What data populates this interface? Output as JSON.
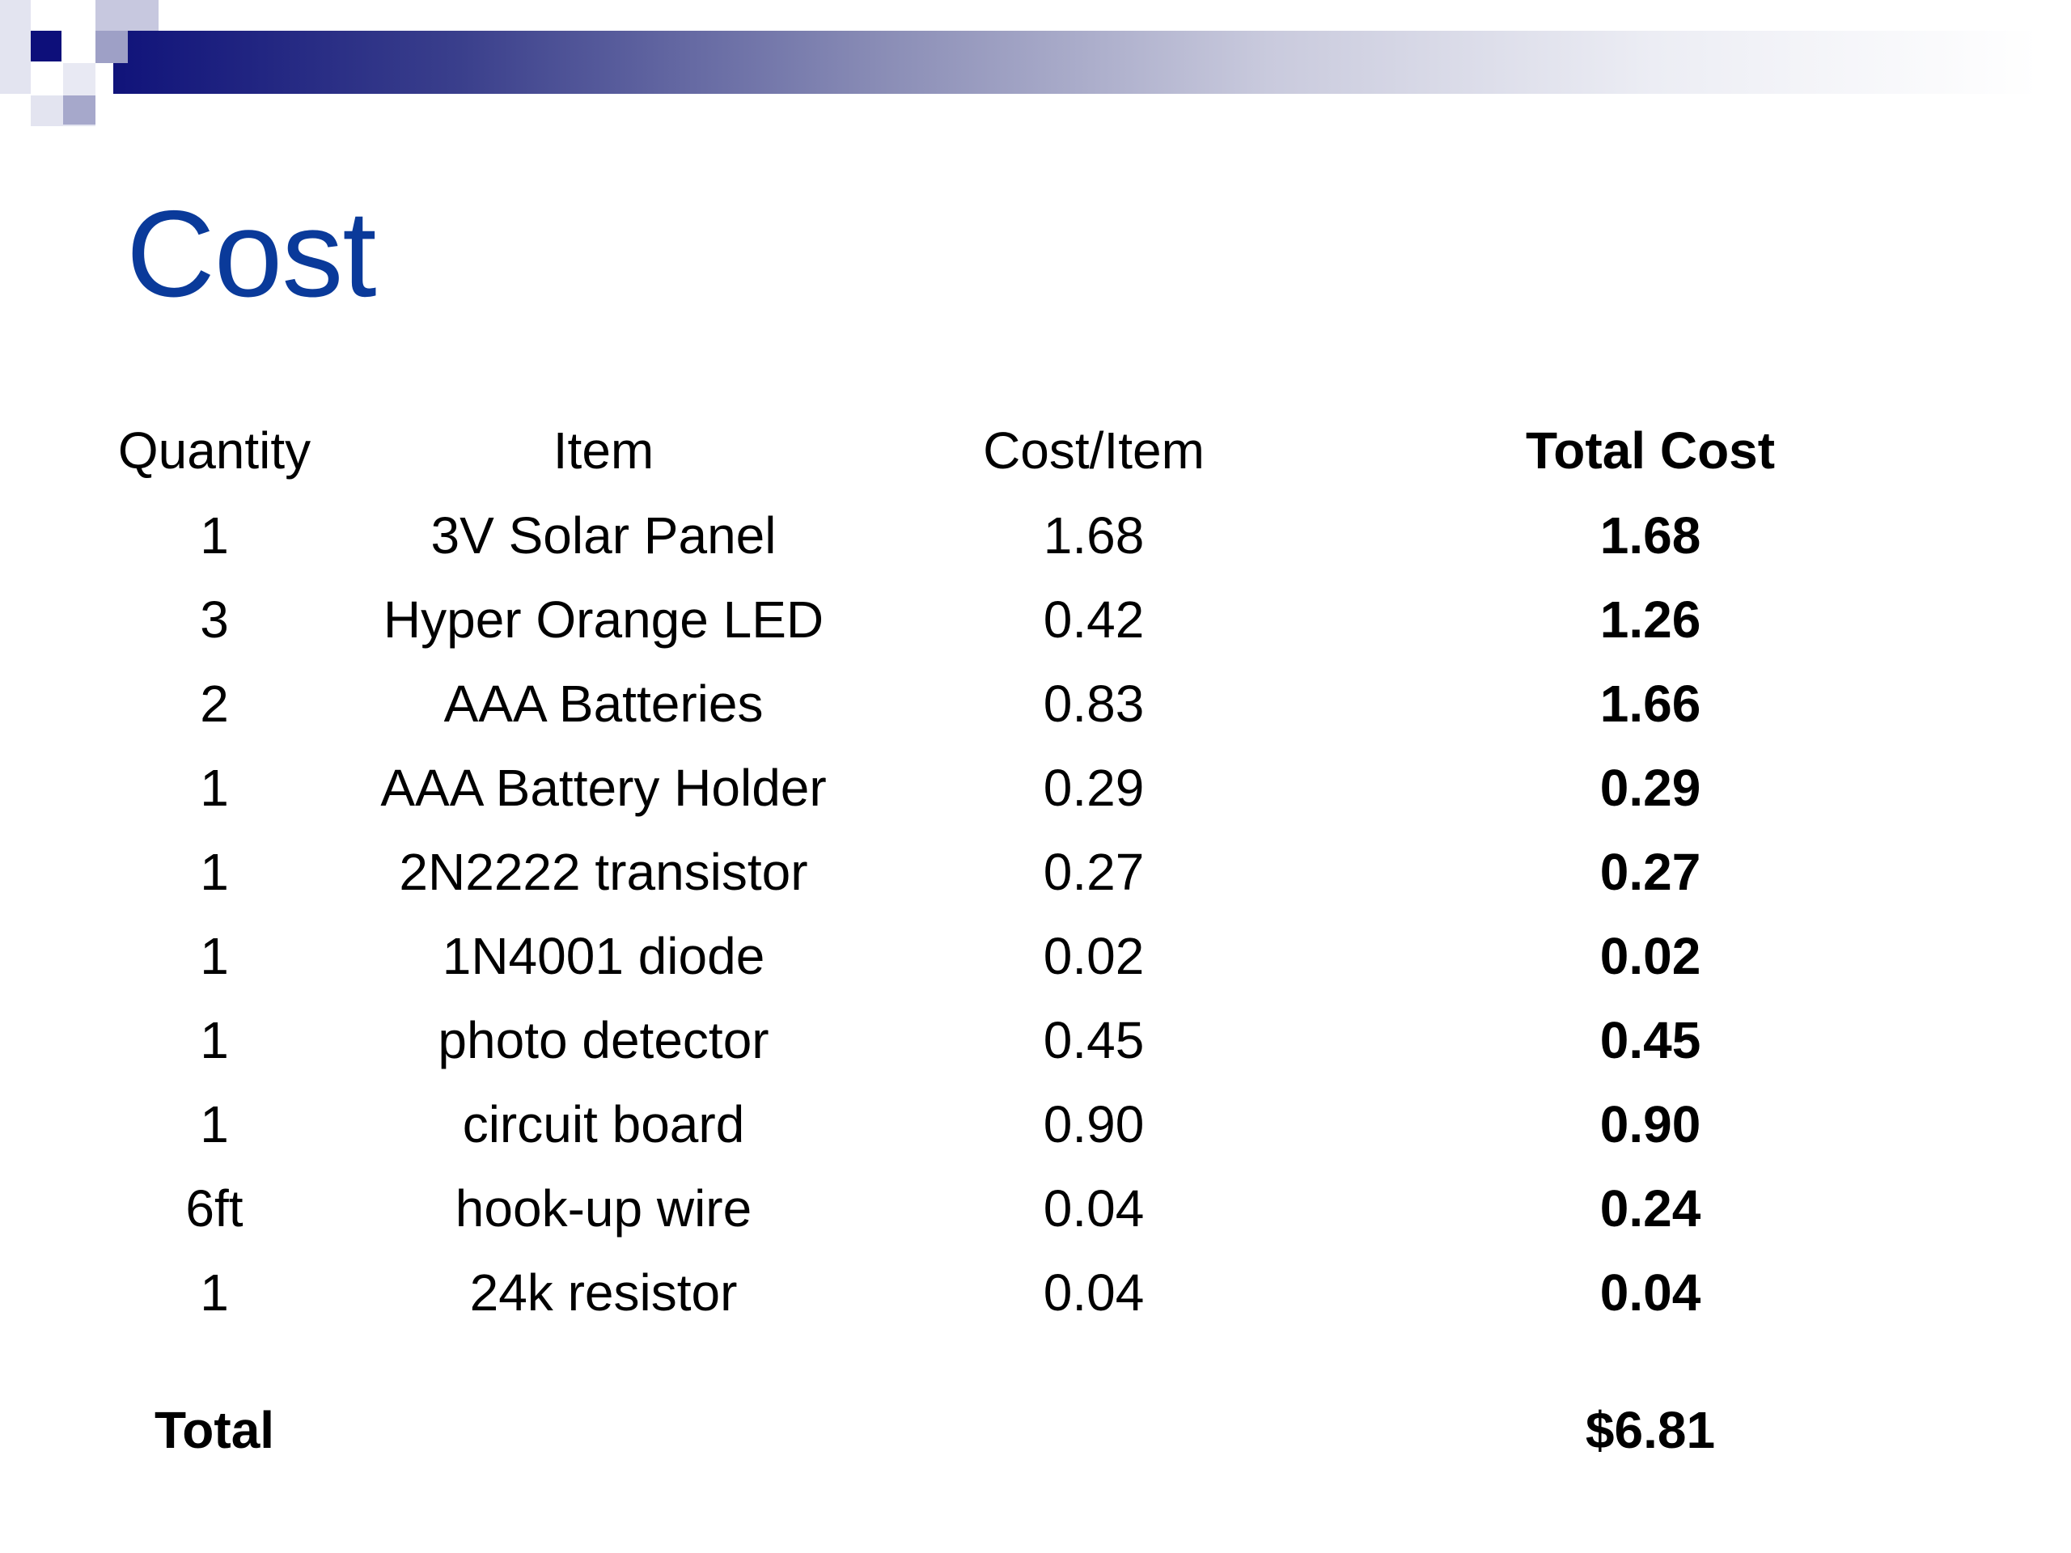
{
  "title": "Cost",
  "table": {
    "headers": {
      "quantity": "Quantity",
      "item": "Item",
      "cost_per_item": "Cost/Item",
      "total_cost": "Total Cost"
    },
    "rows": [
      {
        "quantity": "1",
        "item": "3V Solar Panel",
        "cost_per_item": "1.68",
        "total_cost": "1.68"
      },
      {
        "quantity": "3",
        "item": "Hyper Orange LED",
        "cost_per_item": "0.42",
        "total_cost": "1.26"
      },
      {
        "quantity": "2",
        "item": "AAA Batteries",
        "cost_per_item": "0.83",
        "total_cost": "1.66"
      },
      {
        "quantity": "1",
        "item": "AAA Battery Holder",
        "cost_per_item": "0.29",
        "total_cost": "0.29"
      },
      {
        "quantity": "1",
        "item": "2N2222 transistor",
        "cost_per_item": "0.27",
        "total_cost": "0.27"
      },
      {
        "quantity": "1",
        "item": "1N4001 diode",
        "cost_per_item": "0.02",
        "total_cost": "0.02"
      },
      {
        "quantity": "1",
        "item": "photo detector",
        "cost_per_item": "0.45",
        "total_cost": "0.45"
      },
      {
        "quantity": "1",
        "item": "circuit board",
        "cost_per_item": "0.90",
        "total_cost": "0.90"
      },
      {
        "quantity": "6ft",
        "item": "hook-up wire",
        "cost_per_item": "0.04",
        "total_cost": "0.24"
      },
      {
        "quantity": "1",
        "item": "24k resistor",
        "cost_per_item": "0.04",
        "total_cost": "0.04"
      }
    ],
    "total_label": "Total",
    "total_value": "$6.81"
  },
  "colors": {
    "title": "#0a3a9a",
    "accent_dark": "#10137a"
  }
}
